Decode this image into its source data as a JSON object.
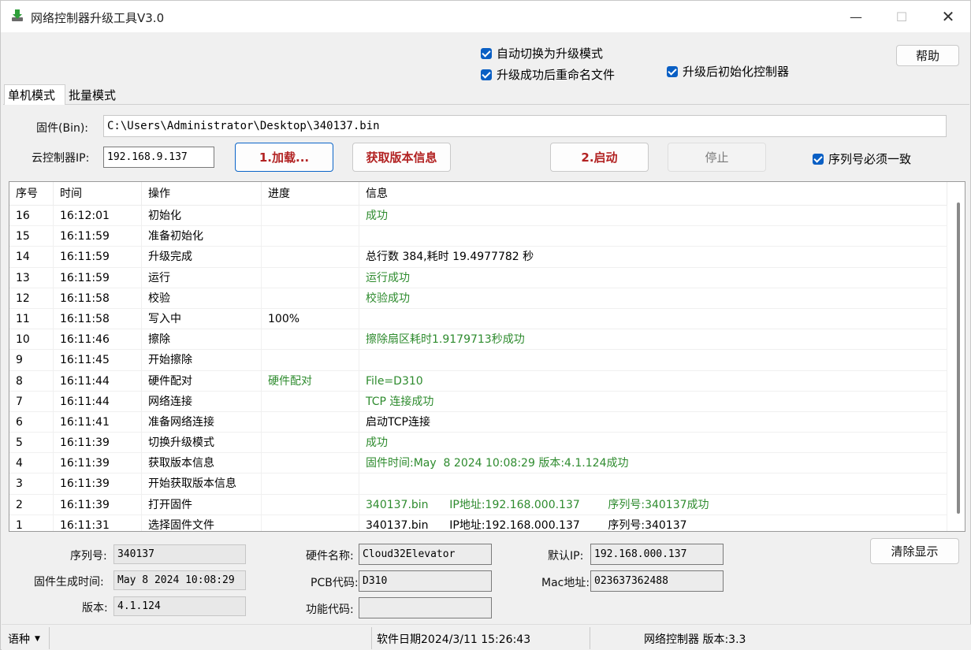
{
  "window": {
    "title": "网络控制器升级工具V3.0"
  },
  "options": {
    "auto_switch": "自动切换为升级模式",
    "rename_after": "升级成功后重命名文件",
    "init_after": "升级后初始化控制器",
    "help_label": "帮助"
  },
  "tabs": [
    "单机模式",
    "批量模式"
  ],
  "form": {
    "firmware_label": "固件(Bin):",
    "firmware_path": "C:\\Users\\Administrator\\Desktop\\340137.bin",
    "cloud_ip_label": "云控制器IP:",
    "cloud_ip": "192.168.9.137",
    "load_button": "1.加载...",
    "get_version_button": "获取版本信息",
    "start_button": "2.启动",
    "stop_button": "停止",
    "serial_must_match": "序列号必须一致"
  },
  "log_table": {
    "headers": [
      "序号",
      "时间",
      "操作",
      "进度",
      "信息"
    ],
    "rows": [
      {
        "no": "16",
        "time": "16:12:01",
        "op": "初始化",
        "progress": "",
        "info": "成功",
        "info_green": true,
        "progress_green": false
      },
      {
        "no": "15",
        "time": "16:11:59",
        "op": "准备初始化",
        "progress": "",
        "info": "",
        "info_green": false,
        "progress_green": false
      },
      {
        "no": "14",
        "time": "16:11:59",
        "op": "升级完成",
        "progress": "",
        "info": "总行数 384,耗时 19.4977782 秒",
        "info_green": false,
        "progress_green": false
      },
      {
        "no": "13",
        "time": "16:11:59",
        "op": "运行",
        "progress": "",
        "info": "运行成功",
        "info_green": true,
        "progress_green": false
      },
      {
        "no": "12",
        "time": "16:11:58",
        "op": "校验",
        "progress": "",
        "info": "校验成功",
        "info_green": true,
        "progress_green": false
      },
      {
        "no": "11",
        "time": "16:11:58",
        "op": "写入中",
        "progress": "100%",
        "info": "",
        "info_green": false,
        "progress_green": false
      },
      {
        "no": "10",
        "time": "16:11:46",
        "op": "擦除",
        "progress": "",
        "info": "擦除扇区耗时1.9179713秒成功",
        "info_green": true,
        "progress_green": false
      },
      {
        "no": "9",
        "time": "16:11:45",
        "op": "开始擦除",
        "progress": "",
        "info": "",
        "info_green": false,
        "progress_green": false
      },
      {
        "no": "8",
        "time": "16:11:44",
        "op": "硬件配对",
        "progress": "硬件配对",
        "info": "File=D310",
        "info_green": true,
        "progress_green": true
      },
      {
        "no": "7",
        "time": "16:11:44",
        "op": "网络连接",
        "progress": "",
        "info": "TCP 连接成功",
        "info_green": true,
        "progress_green": false
      },
      {
        "no": "6",
        "time": "16:11:41",
        "op": "准备网络连接",
        "progress": "",
        "info": "启动TCP连接",
        "info_green": false,
        "progress_green": false
      },
      {
        "no": "5",
        "time": "16:11:39",
        "op": "切换升级模式",
        "progress": "",
        "info": "成功",
        "info_green": true,
        "progress_green": false
      },
      {
        "no": "4",
        "time": "16:11:39",
        "op": "获取版本信息",
        "progress": "",
        "info": "固件时间:May  8 2024 10:08:29 版本:4.1.124成功",
        "info_green": true,
        "progress_green": false
      },
      {
        "no": "3",
        "time": "16:11:39",
        "op": "开始获取版本信息",
        "progress": "",
        "info": "",
        "info_green": false,
        "progress_green": false
      },
      {
        "no": "2",
        "time": "16:11:39",
        "op": "打开固件",
        "progress": "",
        "info": "340137.bin      IP地址:192.168.000.137        序列号:340137成功",
        "info_green": true,
        "progress_green": false
      },
      {
        "no": "1",
        "time": "16:11:31",
        "op": "选择固件文件",
        "progress": "",
        "info": "340137.bin      IP地址:192.168.000.137        序列号:340137",
        "info_green": false,
        "progress_green": false
      }
    ]
  },
  "details": {
    "serial_label": "序列号:",
    "serial": "340137",
    "build_time_label": "固件生成时间:",
    "build_time": "May  8 2024 10:08:29",
    "version_label": "版本:",
    "version": "4.1.124",
    "hw_name_label": "硬件名称:",
    "hw_name": "Cloud32Elevator",
    "pcb_label": "PCB代码:",
    "pcb": "D310",
    "func_code_label": "功能代码:",
    "func_code": "",
    "default_ip_label": "默认IP:",
    "default_ip": "192.168.000.137",
    "mac_label": "Mac地址:",
    "mac": "023637362488",
    "clear_button": "清除显示"
  },
  "statusbar": {
    "language": "语种",
    "software_date": "软件日期2024/3/11 15:26:43",
    "product_version": "网络控制器 版本:3.3"
  },
  "colors": {
    "accent": "#0a5fc4",
    "success_text": "#2e8b2e",
    "action_text": "#b22222"
  }
}
